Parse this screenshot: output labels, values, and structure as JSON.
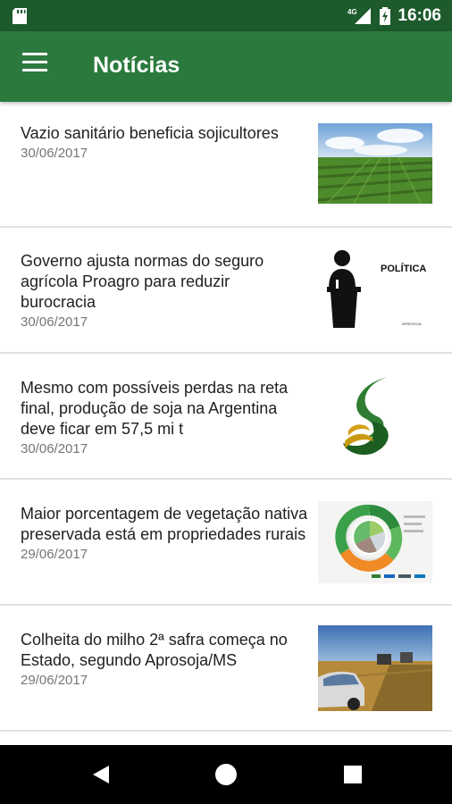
{
  "status_bar": {
    "network": "4G",
    "time": "16:06"
  },
  "app_bar": {
    "title": "Notícias"
  },
  "news": [
    {
      "headline": "Vazio sanitário beneficia sojicultores",
      "date": "30/06/2017",
      "image": "soybean-field-photo"
    },
    {
      "headline": "Governo ajusta normas do seguro agrícola Proagro para reduzir burocracia",
      "date": "30/06/2017",
      "image": "politics-podium-image",
      "image_label": "POLÍTICA",
      "image_logo_text": "APROSOJA"
    },
    {
      "headline": "Mesmo com possíveis perdas na reta final, produção de soja na Argentina deve ficar em 57,5 mi t",
      "date": "30/06/2017",
      "image": "aprosoja-logo"
    },
    {
      "headline": "Maior porcentagem de vegetação nativa preservada está em propriedades rurais",
      "date": "29/06/2017",
      "image": "vegetation-infographic"
    },
    {
      "headline": "Colheita do milho 2ª safra começa no Estado, segundo Aprosoja/MS",
      "date": "29/06/2017",
      "image": "corn-harvest-photo"
    }
  ],
  "colors": {
    "status_bar": "#1d5a2c",
    "app_bar": "#2b7a3d",
    "nav_bar": "#000000"
  }
}
